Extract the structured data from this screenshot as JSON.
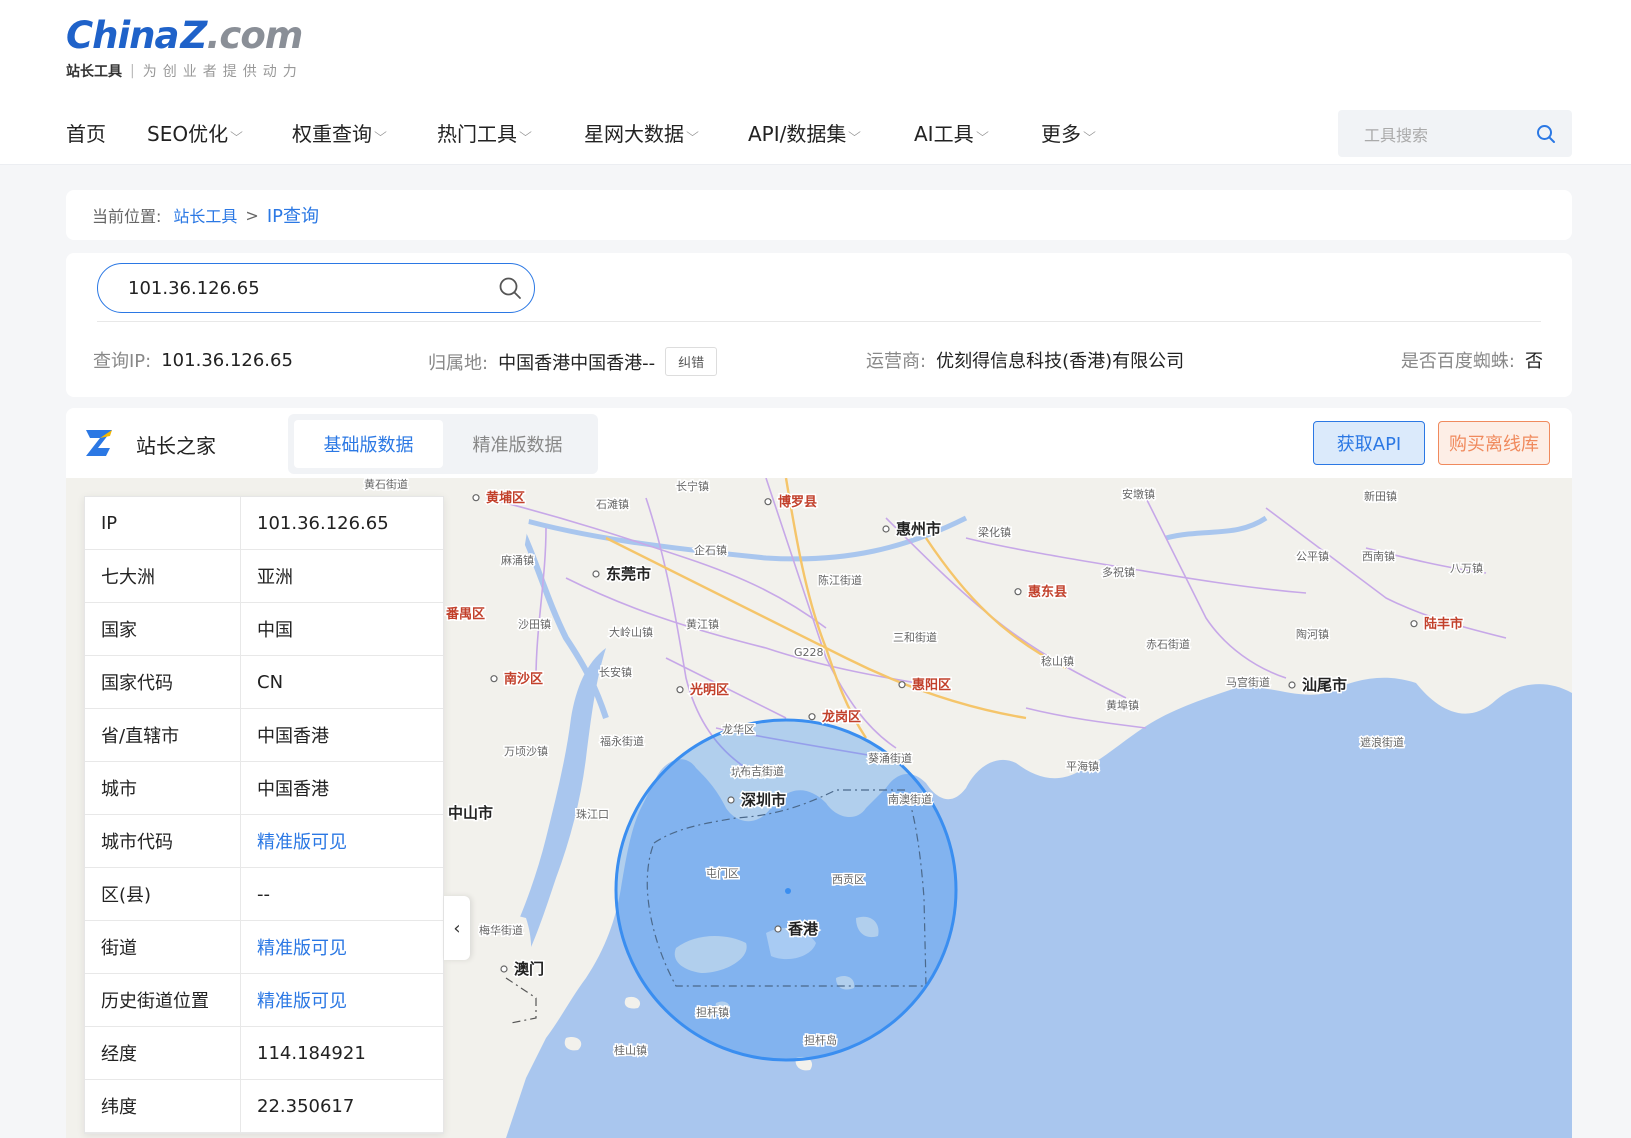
{
  "logo": {
    "main_china": "China",
    "main_z": "Z",
    "main_com": ".com",
    "sub_a": "站长工具",
    "sub_b": "为创业者提供动力"
  },
  "nav": [
    {
      "label": "首页",
      "has_dropdown": false
    },
    {
      "label": "SEO优化",
      "has_dropdown": true
    },
    {
      "label": "权重查询",
      "has_dropdown": true
    },
    {
      "label": "热门工具",
      "has_dropdown": true
    },
    {
      "label": "星网大数据",
      "has_dropdown": true
    },
    {
      "label": "API/数据集",
      "has_dropdown": true
    },
    {
      "label": "AI工具",
      "has_dropdown": true
    },
    {
      "label": "更多",
      "has_dropdown": true
    }
  ],
  "search": {
    "placeholder": "工具搜索"
  },
  "breadcrumb": {
    "label": "当前位置:",
    "home": "站长工具",
    "sep": ">",
    "current": "IP查询"
  },
  "query": {
    "input_value": "101.36.126.65",
    "ip_label": "查询IP:",
    "ip_value": "101.36.126.65",
    "loc_label": "归属地:",
    "loc_value": "中国香港中国香港--",
    "correct_btn": "纠错",
    "isp_label": "运营商:",
    "isp_value": "优刻得信息科技(香港)有限公司",
    "spider_label": "是否百度蜘蛛:",
    "spider_value": "否"
  },
  "section": {
    "title": "站长之家",
    "tabs": [
      {
        "label": "基础版数据",
        "active": true
      },
      {
        "label": "精准版数据",
        "active": false
      }
    ],
    "api_btn": "获取API",
    "buy_btn": "购买离线库"
  },
  "info_table": [
    {
      "key": "IP",
      "value": "101.36.126.65",
      "link": false
    },
    {
      "key": "七大洲",
      "value": "亚洲",
      "link": false
    },
    {
      "key": "国家",
      "value": "中国",
      "link": false
    },
    {
      "key": "国家代码",
      "value": "CN",
      "link": false
    },
    {
      "key": "省/直辖市",
      "value": "中国香港",
      "link": false
    },
    {
      "key": "城市",
      "value": "中国香港",
      "link": false
    },
    {
      "key": "城市代码",
      "value": "精准版可见",
      "link": true
    },
    {
      "key": "区(县)",
      "value": "--",
      "link": false
    },
    {
      "key": "街道",
      "value": "精准版可见",
      "link": true
    },
    {
      "key": "历史街道位置",
      "value": "精准版可见",
      "link": true
    },
    {
      "key": "经度",
      "value": "114.184921",
      "link": false
    },
    {
      "key": "纬度",
      "value": "22.350617",
      "link": false
    }
  ],
  "map": {
    "labels_major": [
      "惠州市",
      "东莞市",
      "深圳市",
      "香港",
      "澳门",
      "中山市",
      "汕尾市"
    ],
    "labels_red": [
      "黄埔区",
      "博罗县",
      "惠东县",
      "陆丰市",
      "南沙区",
      "光明区",
      "龙岗区",
      "惠阳区",
      "番禺区"
    ],
    "labels_minor": [
      "黄石街道",
      "长宁镇",
      "石滩镇",
      "企石镇",
      "麻涌镇",
      "陈江街道",
      "梁化镇",
      "多祝镇",
      "安墩镇",
      "新田镇",
      "公平镇",
      "西南镇",
      "八万镇",
      "沙田镇",
      "大岭山镇",
      "黄江镇",
      "三和街道",
      "赤石街道",
      "陶河镇",
      "长安镇",
      "稔山镇",
      "马宫街道",
      "黄埠镇",
      "福永街道",
      "龙华区",
      "坑梓街道",
      "葵涌街道",
      "平海镇",
      "遮浪街道",
      "万顷沙镇",
      "布吉街道",
      "南澳街道",
      "屯门区",
      "西贡区",
      "梅华街道",
      "担杆镇",
      "担杆岛",
      "桂山镇",
      "珠江口",
      "G228"
    ],
    "colors": {
      "sea": "#a9c6ee",
      "land": "#f2f1ec",
      "circle": "#3a8ef0",
      "road": "#c7a8e8",
      "major_road": "#f5c56a"
    }
  }
}
